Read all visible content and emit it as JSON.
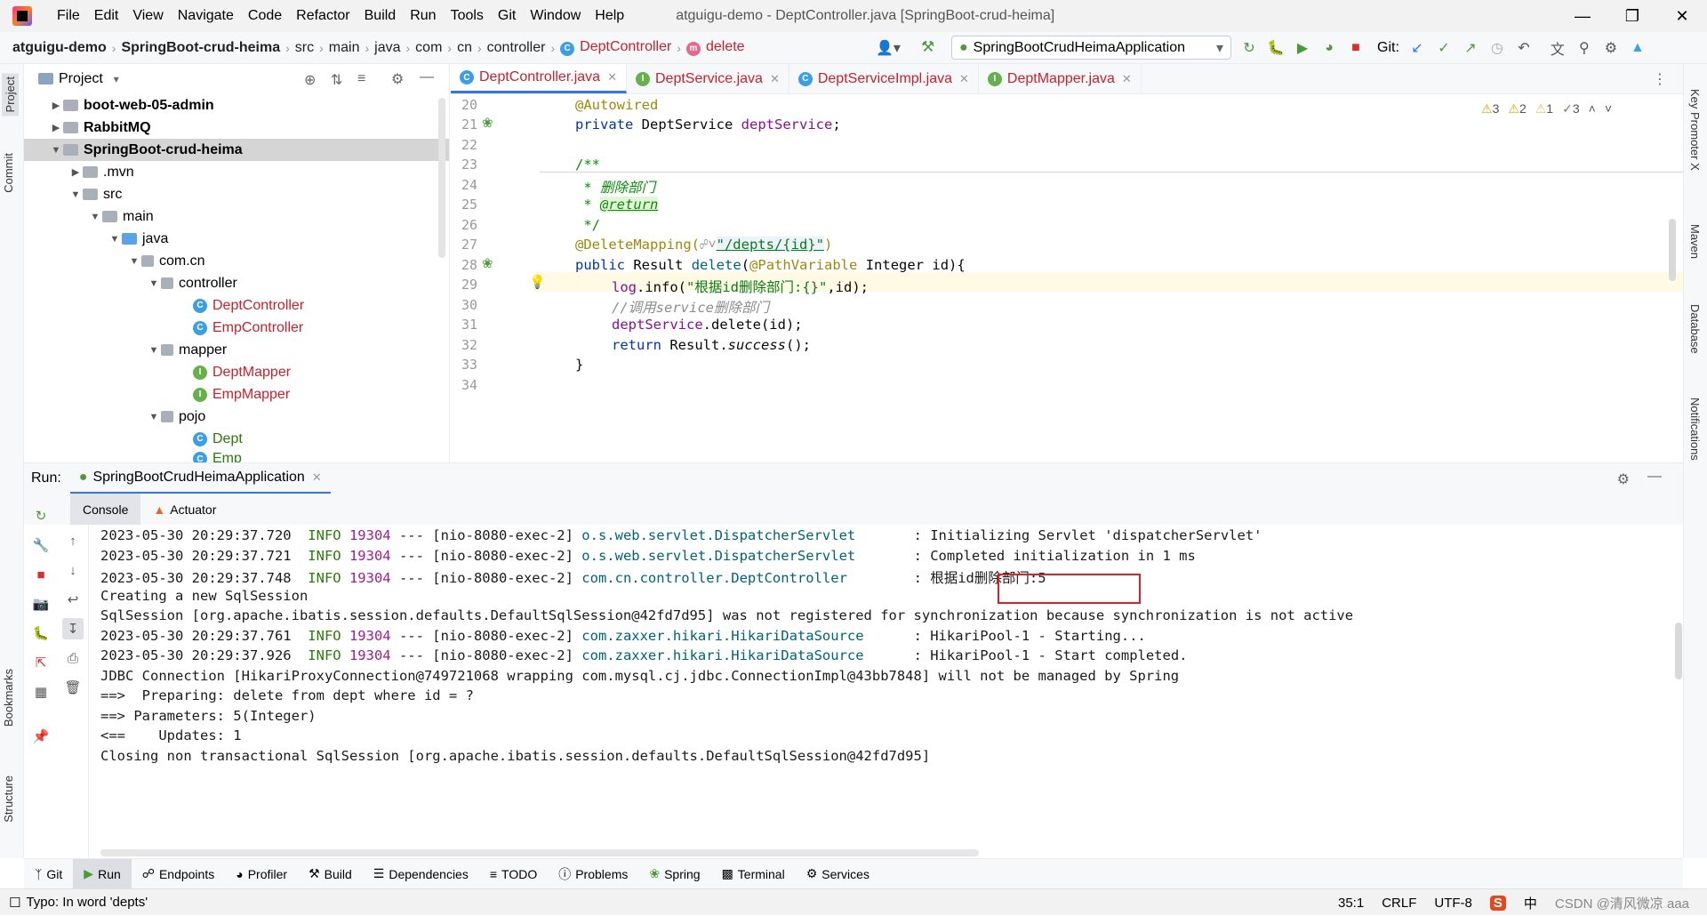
{
  "window": {
    "menus": [
      "File",
      "Edit",
      "View",
      "Navigate",
      "Code",
      "Refactor",
      "Build",
      "Run",
      "Tools",
      "Git",
      "Window",
      "Help"
    ],
    "title": "atguigu-demo - DeptController.java [SpringBoot-crud-heima]"
  },
  "breadcrumb": [
    "atguigu-demo",
    "SpringBoot-crud-heima",
    "src",
    "main",
    "java",
    "com",
    "cn",
    "controller",
    "DeptController",
    "delete"
  ],
  "toolbar": {
    "run_config": "SpringBootCrudHeimaApplication",
    "git_label": "Git:"
  },
  "left_strip": {
    "project": "Project",
    "commit": "Commit",
    "bookmarks": "Bookmarks",
    "structure": "Structure"
  },
  "right_strip": {
    "key_promoter": "Key Promoter X",
    "maven": "Maven",
    "database": "Database",
    "notifications": "Notifications"
  },
  "project_pane": {
    "title": "Project",
    "tree": [
      {
        "label": "boot-web-05-admin",
        "kind": "module",
        "bold": true
      },
      {
        "label": "RabbitMQ",
        "kind": "module",
        "bold": true
      },
      {
        "label": "SpringBoot-crud-heima",
        "kind": "module",
        "bold": true,
        "selected": true
      },
      {
        "label": ".mvn",
        "kind": "folder"
      },
      {
        "label": "src",
        "kind": "folder"
      },
      {
        "label": "main",
        "kind": "folder"
      },
      {
        "label": "java",
        "kind": "folder-blue"
      },
      {
        "label": "com.cn",
        "kind": "package"
      },
      {
        "label": "controller",
        "kind": "package"
      },
      {
        "label": "DeptController",
        "kind": "class",
        "color": "red"
      },
      {
        "label": "EmpController",
        "kind": "class",
        "color": "red"
      },
      {
        "label": "mapper",
        "kind": "package"
      },
      {
        "label": "DeptMapper",
        "kind": "interface",
        "color": "red"
      },
      {
        "label": "EmpMapper",
        "kind": "interface",
        "color": "red"
      },
      {
        "label": "pojo",
        "kind": "package"
      },
      {
        "label": "Dept",
        "kind": "class",
        "color": "green"
      },
      {
        "label": "Emp",
        "kind": "class",
        "color": "green"
      }
    ]
  },
  "editor_tabs": [
    {
      "label": "DeptController.java",
      "icon": "C",
      "active": true
    },
    {
      "label": "DeptService.java",
      "icon": "I"
    },
    {
      "label": "DeptServiceImpl.java",
      "icon": "C"
    },
    {
      "label": "DeptMapper.java",
      "icon": "I"
    }
  ],
  "inspections": {
    "warn1": "3",
    "warn2": "2",
    "warn3": "1",
    "ok": "3"
  },
  "code": {
    "line_numbers": [
      "20",
      "21",
      "22",
      "23",
      "24",
      "25",
      "26",
      "27",
      "28",
      "29",
      "30",
      "31",
      "32",
      "33",
      "34"
    ],
    "l20_ann": "@Autowired",
    "l21_kw": "private",
    "l21_type": "DeptService",
    "l21_field": "deptService",
    "l23": "/**",
    "l24": " * 删除部门",
    "l25_pre": " * ",
    "l25_tag": "@return",
    "l26": " */",
    "l27_ann": "@DeleteMapping(",
    "l27_str": "\"/depts/{id}\"",
    "l27_end": ")",
    "l28_kw": "public",
    "l28_type": "Result",
    "l28_method": "delete",
    "l28_ann": "@PathVariable",
    "l28_rest": "Integer id){",
    "l29_obj": "log",
    "l29_m": ".info(",
    "l29_str": "\"根据id删除部门:{}\"",
    "l29_end": ",id);",
    "l30": "//调用service删除部门",
    "l31_obj": "deptService",
    "l31_rest": ".delete(id);",
    "l32_kw": "return",
    "l32_type": "Result.",
    "l32_m": "success",
    "l32_end": "();",
    "l33": "}"
  },
  "run_panel": {
    "run_label": "Run:",
    "run_tab": "SpringBootCrudHeimaApplication",
    "subtabs": [
      "Console",
      "Actuator"
    ]
  },
  "console": {
    "lines": [
      {
        "ts": "2023-05-30 20:29:37.720",
        "lvl": "INFO",
        "pid": "19304",
        "thread": "--- [nio-8080-exec-2]",
        "logger": "o.s.web.servlet.DispatcherServlet      ",
        "msg": ": Initializing Servlet 'dispatcherServlet'"
      },
      {
        "ts": "2023-05-30 20:29:37.721",
        "lvl": "INFO",
        "pid": "19304",
        "thread": "--- [nio-8080-exec-2]",
        "logger": "o.s.web.servlet.DispatcherServlet      ",
        "msg": ": Completed initialization in 1 ms"
      },
      {
        "ts": "2023-05-30 20:29:37.748",
        "lvl": "INFO",
        "pid": "19304",
        "thread": "--- [nio-8080-exec-2]",
        "logger": "com.cn.controller.DeptController       ",
        "msg": ": 根据id删除部门:5"
      },
      {
        "plain": "Creating a new SqlSession"
      },
      {
        "plain": "SqlSession [org.apache.ibatis.session.defaults.DefaultSqlSession@42fd7d95] was not registered for synchronization because synchronization is not active"
      },
      {
        "ts": "2023-05-30 20:29:37.761",
        "lvl": "INFO",
        "pid": "19304",
        "thread": "--- [nio-8080-exec-2]",
        "logger": "com.zaxxer.hikari.HikariDataSource     ",
        "msg": ": HikariPool-1 - Starting..."
      },
      {
        "ts": "2023-05-30 20:29:37.926",
        "lvl": "INFO",
        "pid": "19304",
        "thread": "--- [nio-8080-exec-2]",
        "logger": "com.zaxxer.hikari.HikariDataSource     ",
        "msg": ": HikariPool-1 - Start completed."
      },
      {
        "plain": "JDBC Connection [HikariProxyConnection@749721068 wrapping com.mysql.cj.jdbc.ConnectionImpl@43bb7848] will not be managed by Spring"
      },
      {
        "plain": "==>  Preparing: delete from dept where id = ?"
      },
      {
        "plain": "==> Parameters: 5(Integer)"
      },
      {
        "plain": "<==    Updates: 1"
      },
      {
        "plain": "Closing non transactional SqlSession [org.apache.ibatis.session.defaults.DefaultSqlSession@42fd7d95]"
      }
    ]
  },
  "bottom_tabs": [
    "Git",
    "Run",
    "Endpoints",
    "Profiler",
    "Build",
    "Dependencies",
    "TODO",
    "Problems",
    "Spring",
    "Terminal",
    "Services"
  ],
  "status": {
    "message": "Typo: In word 'depts'",
    "position": "35:1",
    "line_sep": "CRLF",
    "encoding": "UTF-8",
    "ime": "中",
    "watermark": "CSDN @清风微凉 aaa"
  }
}
